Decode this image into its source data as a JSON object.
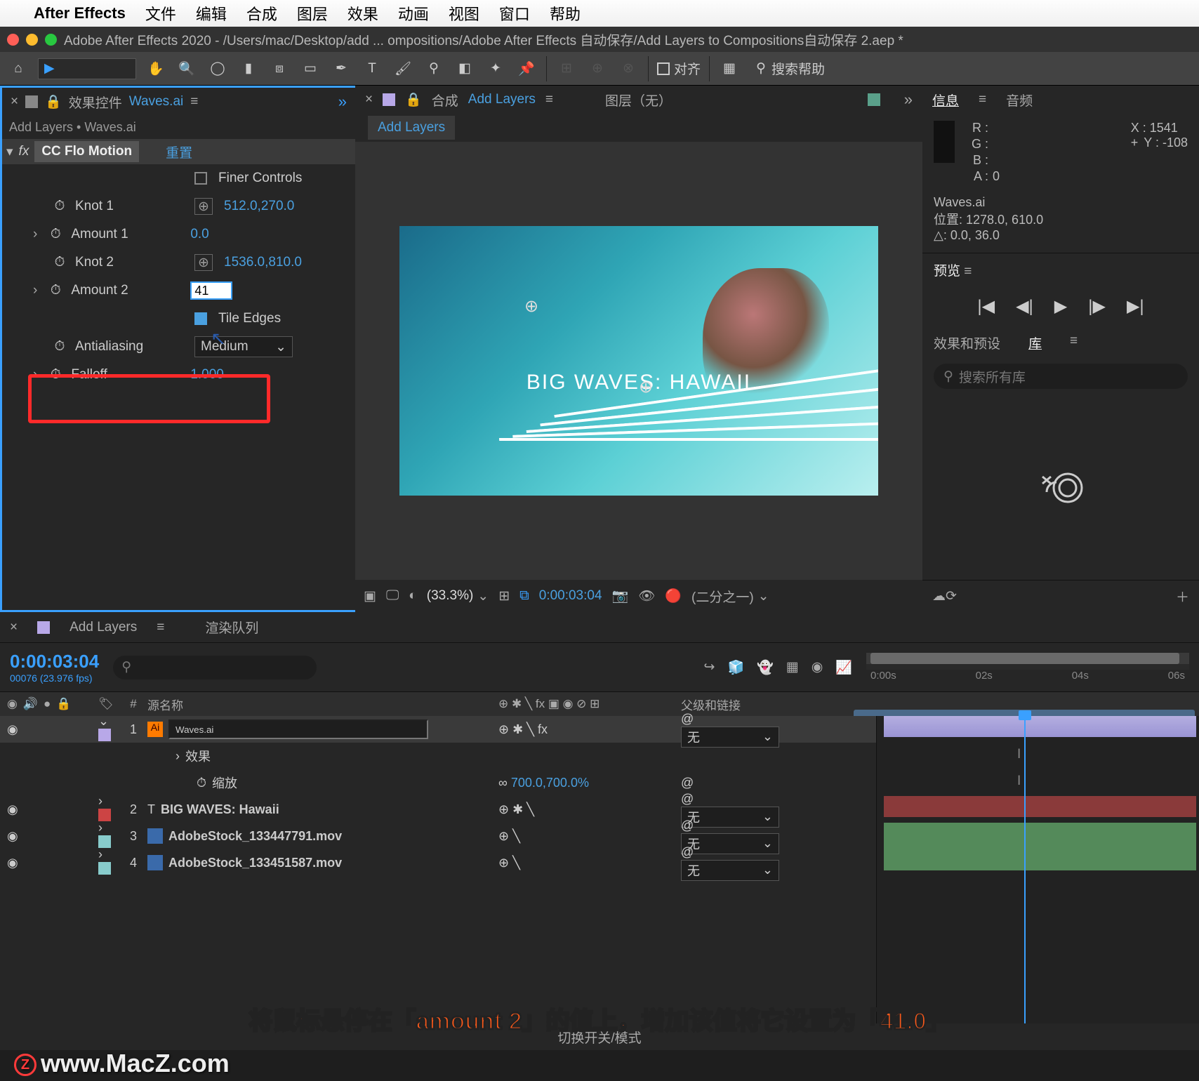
{
  "menubar": {
    "apple": "",
    "app": "After Effects",
    "items": [
      "文件",
      "编辑",
      "合成",
      "图层",
      "效果",
      "动画",
      "视图",
      "窗口",
      "帮助"
    ]
  },
  "titlebar": "Adobe After Effects 2020 - /Users/mac/Desktop/add ... ompositions/Adobe After Effects 自动保存/Add Layers to Compositions自动保存 2.aep *",
  "toolbar": {
    "snap": "对齐",
    "search": "搜索帮助"
  },
  "left": {
    "tab": "效果控件",
    "tablink": "Waves.ai",
    "crumb": "Add Layers • Waves.ai",
    "fxname": "CC Flo Motion",
    "reset": "重置",
    "p_finer": "Finer Controls",
    "p_knot1": "Knot 1",
    "v_knot1": "512.0,270.0",
    "p_amount1": "Amount 1",
    "v_amount1": "0.0",
    "p_knot2": "Knot 2",
    "v_knot2": "1536.0,810.0",
    "p_amount2": "Amount 2",
    "v_amount2": "41",
    "p_tile": "Tile Edges",
    "p_aa": "Antialiasing",
    "v_aa": "Medium",
    "p_falloff": "Falloff",
    "v_falloff": "1.000"
  },
  "center": {
    "tab_comp": "合成",
    "tab_complink": "Add Layers",
    "tab_layer": "图层（无）",
    "subtab": "Add Layers",
    "frametxt": "BIG WAVES: HAWAII",
    "pct": "(33.3%)",
    "tc": "0:00:03:04",
    "res": "(二分之一)"
  },
  "right": {
    "tab_info": "信息",
    "tab_audio": "音频",
    "R": "R :",
    "G": "G :",
    "B": "B :",
    "A": "A :",
    "Aval": "0",
    "X": "X : 1541",
    "Y": "Y : -108",
    "layer": "Waves.ai",
    "pos": "位置: 1278.0, 610.0",
    "delta": "△: 0.0, 36.0",
    "prev": "预览",
    "fxpre": "效果和预设",
    "lib": "库",
    "search_ph": "搜索所有库"
  },
  "timeline": {
    "tab": "Add Layers",
    "renderq": "渲染队列",
    "tc": "0:00:03:04",
    "fps": "00076 (23.976 fps)",
    "col_num": "#",
    "col_src": "源名称",
    "col_par": "父级和链接",
    "ticks": [
      "0:00s",
      "02s",
      "04s",
      "06s"
    ],
    "r1": {
      "num": "1",
      "name": "Waves.ai",
      "par": "无"
    },
    "r1fx": "效果",
    "r1scale_l": "缩放",
    "r1scale_v": "700.0,700.0%",
    "r2": {
      "num": "2",
      "name": "BIG WAVES: Hawaii",
      "par": "无"
    },
    "r3": {
      "num": "3",
      "name": "AdobeStock_133447791.mov",
      "par": "无"
    },
    "r4": {
      "num": "4",
      "name": "AdobeStock_133451587.mov",
      "par": "无"
    },
    "foot": "切换开关/模式"
  },
  "bottom": "将鼠标悬停在「amount 2」的值上，增加该值将它设置为「41.0」",
  "watermark": "www.MacZ.com"
}
